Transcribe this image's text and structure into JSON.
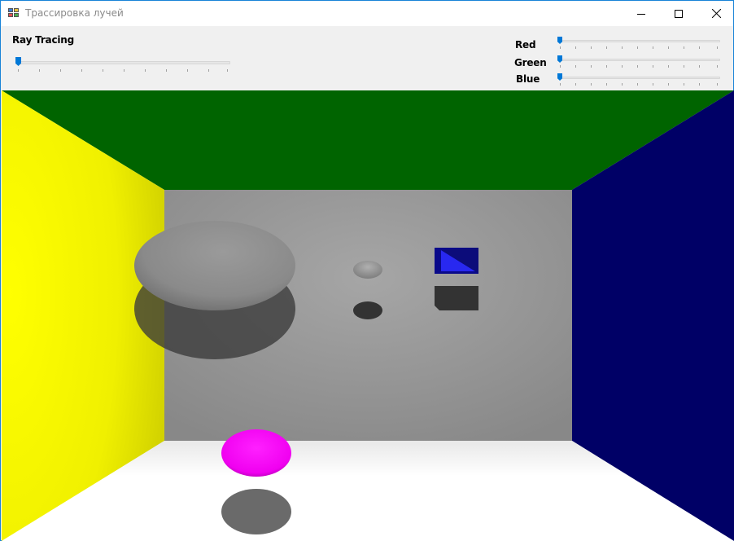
{
  "window": {
    "title": "Трассировка лучей"
  },
  "controls": {
    "raytracing": {
      "label": "Ray Tracing",
      "value": 0
    },
    "red": {
      "label": "Red",
      "value": 0
    },
    "green": {
      "label": "Green",
      "value": 0
    },
    "blue": {
      "label": "Blue",
      "value": 0
    }
  },
  "scene": {
    "colors": {
      "ceiling": "#006400",
      "left_wall": "#ffff00",
      "right_wall": "#000066",
      "back_wall": "#999999",
      "floor": "#ffffff",
      "big_sphere": "#8c8c8c",
      "small_sphere": "#a0a0a0",
      "cube": "#2020e0",
      "magenta_sphere": "#ff00ff",
      "shadow": "#333333"
    }
  }
}
